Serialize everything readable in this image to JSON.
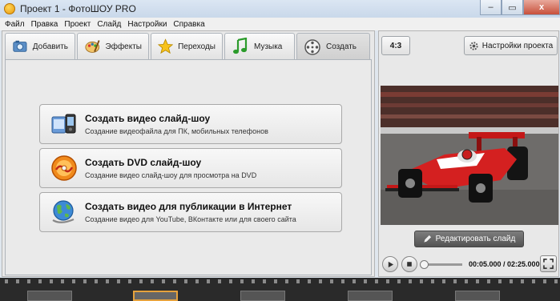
{
  "window": {
    "title": "Проект 1 - ФотоШОУ PRO",
    "minimize": "–",
    "maximize": "▭",
    "close": "x"
  },
  "menu": [
    "Файл",
    "Правка",
    "Проект",
    "Слайд",
    "Настройки",
    "Справка"
  ],
  "tabs": [
    {
      "label": "Добавить",
      "icon": "photo-icon"
    },
    {
      "label": "Эффекты",
      "icon": "palette-icon"
    },
    {
      "label": "Переходы",
      "icon": "star-icon"
    },
    {
      "label": "Музыка",
      "icon": "music-note-icon"
    },
    {
      "label": "Создать",
      "icon": "film-reel-icon",
      "active": true
    }
  ],
  "create_options": [
    {
      "title": "Создать видео слайд-шоу",
      "desc": "Создание видеофайла для ПК, мобильных телефонов",
      "icon": "video-device-icon"
    },
    {
      "title": "Создать DVD слайд-шоу",
      "desc": "Создание видео слайд-шоу для просмотра на DVD",
      "icon": "dvd-disc-icon"
    },
    {
      "title": "Создать видео для публикации в Интернет",
      "desc": "Создание видео для YouTube, ВКонтакте или для своего сайта",
      "icon": "globe-icon"
    }
  ],
  "right": {
    "ratio": "4:3",
    "settings_label": "Настройки проекта",
    "edit_label": "Редактировать слайд",
    "timecode": "00:05.000 / 02:25.000",
    "playback_progress": 0.03
  }
}
